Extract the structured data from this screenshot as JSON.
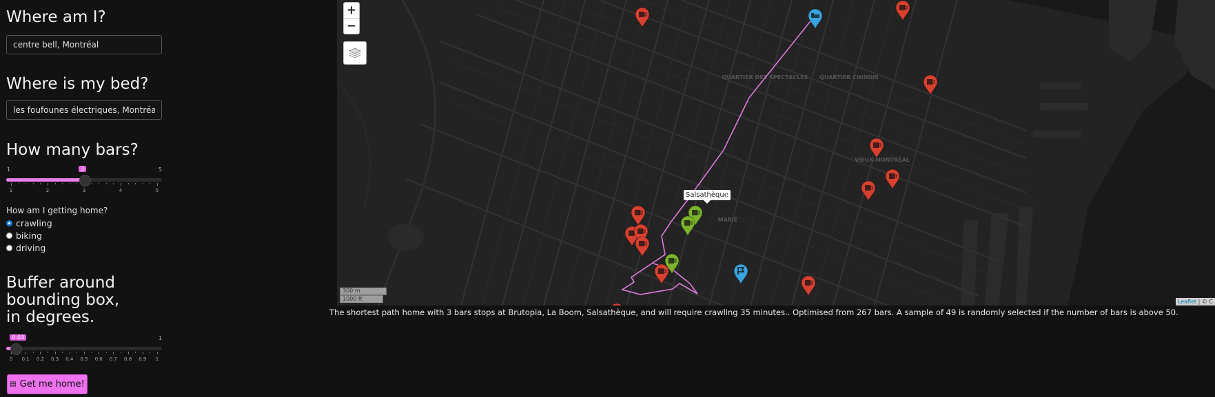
{
  "form": {
    "where_label": "Where am I?",
    "where_value": "centre bell, Montréal",
    "bed_label": "Where is my bed?",
    "bed_value": "les foufounes électriques, Montréal",
    "bars_label": "How many bars?",
    "bars_slider": {
      "min": "1",
      "max": "5",
      "value": "3",
      "value_num": 3,
      "min_num": 1,
      "max_num": 5,
      "ticks": [
        "1",
        "2",
        "3",
        "4",
        "5"
      ]
    },
    "transport_label": "How am I getting home?",
    "transport_options": [
      {
        "label": "crawling",
        "selected": true
      },
      {
        "label": "biking",
        "selected": false
      },
      {
        "label": "driving",
        "selected": false
      }
    ],
    "buffer_label": "Buffer around bounding box, in degrees.",
    "buffer_slider": {
      "min": "0",
      "max": "1",
      "value": "0.03",
      "value_num": 0.03,
      "min_num": 0,
      "max_num": 1,
      "ticks": [
        "0",
        "0.1",
        "0.2",
        "0.3",
        "0.4",
        "0.5",
        "0.6",
        "0.7",
        "0.8",
        "0.9",
        "1"
      ]
    },
    "submit_label": "Get me home!",
    "submit_icon": "route-icon"
  },
  "map": {
    "zoom_in": "+",
    "zoom_out": "−",
    "layers_icon": "layers-icon",
    "popup_text": "Salsathèque",
    "popup_close": "×",
    "scale_metric": "300 m",
    "scale_imperial": "1000 ft",
    "attribution_leaflet": "Leaflet",
    "attribution_rest": " | © C",
    "district_labels": [
      "QUARTIER DES SPECTACLES",
      "QUARTIER CHINOIS",
      "VIEUX-MONTRÉAL",
      "MARIE"
    ],
    "marker_colors": {
      "bar": "#d8402f",
      "stop": "#7cb32d",
      "endpoint": "#3aa2dc"
    },
    "route_color": "#e07ae0"
  },
  "result_text": "The shortest path home with 3 bars stops at Brutopia, La Boom, Salsathèque, and will require crawling 35 minutes.. Optimised from 267 bars. A sample of 49 is randomly selected if the number of bars is above 50."
}
